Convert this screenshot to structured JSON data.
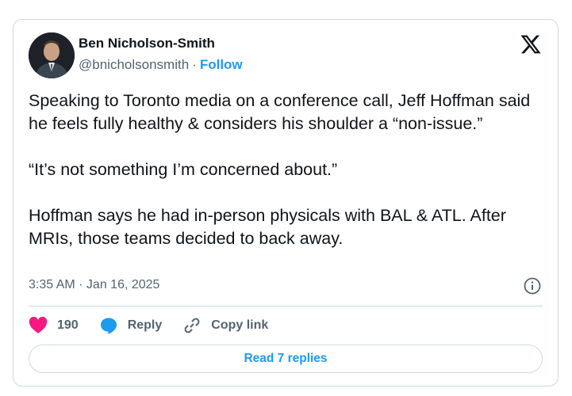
{
  "author": {
    "name": "Ben Nicholson-Smith",
    "handle": "@bnicholsonsmith",
    "separator": "·",
    "follow_label": "Follow"
  },
  "tweet": {
    "text": "Speaking to Toronto media on a conference call, Jeff Hoffman said he feels fully healthy & considers his shoulder a “non-issue.”\n\n“It’s not something I’m concerned about.”\n\nHoffman says he had in-person physicals with BAL & ATL. After MRIs, those teams decided to back away.",
    "timestamp": "3:35 AM · Jan 16, 2025"
  },
  "actions": {
    "like_count": "190",
    "reply_label": "Reply",
    "copy_link_label": "Copy link"
  },
  "read_replies_label": "Read 7 replies",
  "icons": {
    "platform": "x-logo-icon",
    "info": "info-icon",
    "like": "heart-icon",
    "reply": "speech-bubble-icon",
    "copy": "link-icon"
  },
  "colors": {
    "accent": "#1d9bf0",
    "like": "#f91880",
    "muted": "#536471",
    "text": "#0f1419",
    "border": "#cfd9de"
  }
}
